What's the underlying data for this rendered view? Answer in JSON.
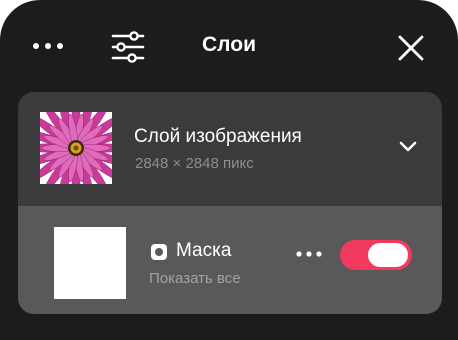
{
  "header": {
    "title": "Слои",
    "more_icon": "more-horizontal-icon",
    "filter_icon": "sliders-icon",
    "close_icon": "close-icon"
  },
  "layer": {
    "name": "Слой изображения",
    "size": "2848 × 2848 пикс",
    "thumbnail": "pink-flower-image",
    "expand_icon": "chevron-down-icon"
  },
  "mask": {
    "icon": "mask-icon",
    "name": "Маска",
    "subtitle": "Показать все",
    "more_icon": "more-horizontal-icon",
    "enabled": true
  },
  "colors": {
    "background": "#1c1c1d",
    "card": "#3b3b3c",
    "mask_row": "#59595b",
    "accent": "#f23a5e",
    "text_primary": "#ffffff",
    "text_secondary": "#8e8e90"
  }
}
